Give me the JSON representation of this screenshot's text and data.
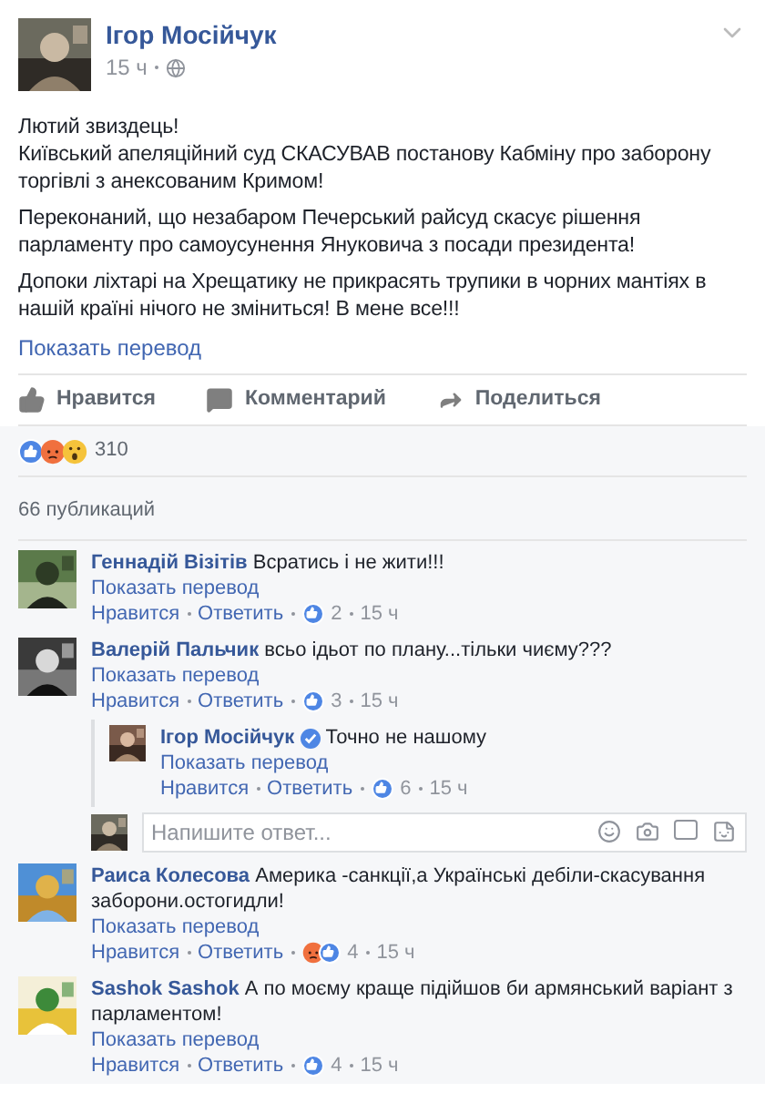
{
  "post": {
    "author": "Ігор Мосійчук",
    "time": "15 ч",
    "paragraphs": [
      [
        "Лютий звиздець!",
        "Київський апеляційний суд СКАСУВАВ постанову Кабміну про заборону торгівлі з анексованим Кримом!"
      ],
      [
        "Переконаний, що незабаром Печерський райсуд скасує рішення парламенту про самоусунення Януковича з посади президента!"
      ],
      [
        "Допоки ліхтарі на Хрещатику не прикрасять трупики в чорних мантіях в нашій країні нічого не зміниться! В мене все!!!"
      ]
    ],
    "translate": "Показать перевод"
  },
  "actions": [
    {
      "kind": "like",
      "label": "Нравится"
    },
    {
      "kind": "comment",
      "label": "Комментарий"
    },
    {
      "kind": "share",
      "label": "Поделиться"
    }
  ],
  "reactions": {
    "kinds": [
      {
        "kind": "like"
      },
      {
        "kind": "angry"
      },
      {
        "kind": "wow"
      }
    ],
    "count": "310"
  },
  "publications": "66 публикаций",
  "comments": [
    {
      "author": "Геннадій Візітів",
      "text": "Всратись і не жити!!!",
      "translate": "Показать перевод",
      "like": "Нравится",
      "reply": "Ответить",
      "reactions": [
        {
          "kind": "like"
        }
      ],
      "count": "2",
      "time": "15 ч"
    },
    {
      "author": "Валерій Пальчик",
      "text": "всьо ідьот по плану...тільки чиєму???",
      "translate": "Показать перевод",
      "like": "Нравится",
      "reply": "Ответить",
      "reactions": [
        {
          "kind": "like"
        }
      ],
      "count": "3",
      "time": "15 ч",
      "replies": [
        {
          "author": "Ігор Мосійчук",
          "text": "Точно не нашому",
          "translate": "Показать перевод",
          "like": "Нравится",
          "reply": "Ответить",
          "reactions": [
            {
              "kind": "like"
            }
          ],
          "count": "6",
          "time": "15 ч",
          "verified": true
        }
      ],
      "reply_placeholder": "Напишите ответ..."
    },
    {
      "author": "Раиса Колесова",
      "text": "Америка -санкції,а Українські дебіли-скасування заборони.остогидли!",
      "translate": "Показать перевод",
      "like": "Нравится",
      "reply": "Ответить",
      "reactions": [
        {
          "kind": "angry"
        },
        {
          "kind": "like"
        }
      ],
      "count": "4",
      "time": "15 ч"
    },
    {
      "author": "Sashok Sashok",
      "text": "А по моєму краще підійшов би армянський варіант з парламентом!",
      "translate": "Показать перевод",
      "like": "Нравится",
      "reply": "Ответить",
      "reactions": [
        {
          "kind": "like"
        }
      ],
      "count": "4",
      "time": "15 ч"
    }
  ]
}
